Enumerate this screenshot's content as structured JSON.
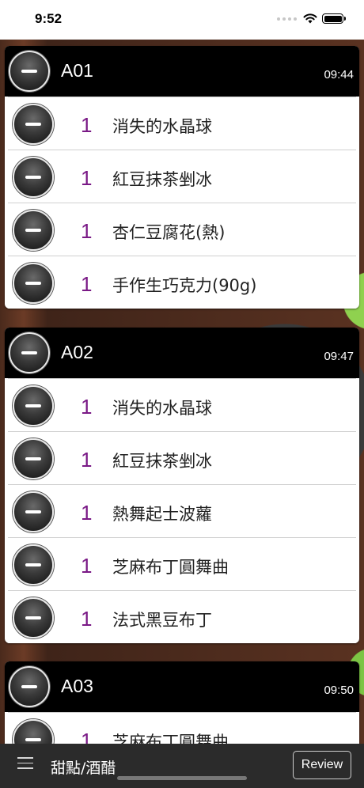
{
  "status_bar": {
    "time": "9:52"
  },
  "orders": [
    {
      "table": "A01",
      "time": "09:44",
      "items": [
        {
          "qty": "1",
          "name": "消失的水晶球"
        },
        {
          "qty": "1",
          "name": "紅豆抹茶剉冰"
        },
        {
          "qty": "1",
          "name": "杏仁豆腐花(熱)"
        },
        {
          "qty": "1",
          "name": "手作生巧克力(90g)"
        }
      ]
    },
    {
      "table": "A02",
      "time": "09:47",
      "items": [
        {
          "qty": "1",
          "name": "消失的水晶球"
        },
        {
          "qty": "1",
          "name": "紅豆抹茶剉冰"
        },
        {
          "qty": "1",
          "name": "熱舞起士波蘿"
        },
        {
          "qty": "1",
          "name": "芝麻布丁圓舞曲"
        },
        {
          "qty": "1",
          "name": "法式黑豆布丁"
        }
      ]
    },
    {
      "table": "A03",
      "time": "09:50",
      "items": [
        {
          "qty": "1",
          "name": "芝麻布丁圓舞曲"
        }
      ]
    }
  ],
  "bottom_bar": {
    "category": "甜點/酒醋",
    "review_label": "Review"
  },
  "icons": {
    "remove": "minus-circle-icon",
    "menu": "hamburger-menu-icon",
    "wifi": "wifi-icon",
    "battery": "battery-icon"
  },
  "colors": {
    "quantity": "#7a1a86",
    "header": "#000000",
    "bottom_bar": "#2b2b2b"
  }
}
